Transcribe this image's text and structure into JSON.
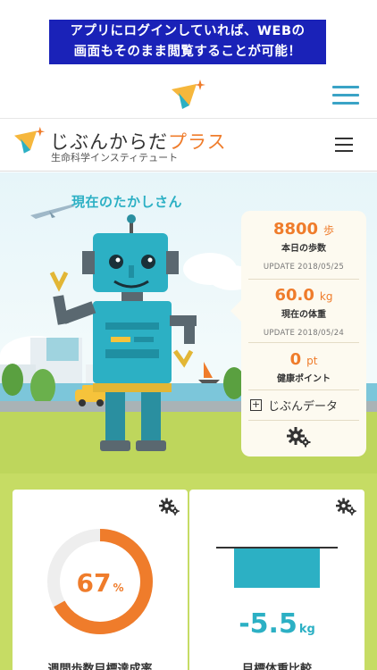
{
  "banner": {
    "line1": "アプリにログインしていれば、WEBの",
    "line2": "画面もそのまま閲覧することが可能！"
  },
  "header": {
    "brand_name_main": "じぶんからだ",
    "brand_name_accent": "プラス",
    "brand_sub": "生命科学インスティテュート"
  },
  "hero": {
    "title": "現在のたかしさん"
  },
  "stats": {
    "steps": {
      "value": "8800",
      "unit": "歩",
      "label": "本日の歩数",
      "update": "UPDATE  2018/05/25"
    },
    "weight": {
      "value": "60.0",
      "unit": "kg",
      "label": "現在の体重",
      "update": "UPDATE  2018/05/24"
    },
    "points": {
      "value": "0",
      "unit": "pt",
      "label": "健康ポイント"
    },
    "link_label": "じぶんデータ",
    "link_icon": "plus-box-icon"
  },
  "cards": {
    "steps_goal": {
      "value": "67",
      "unit": "%",
      "title": "週間歩数目標達成率",
      "progress": 0.67
    },
    "weight_goal": {
      "value": "-5.5",
      "unit": "kg",
      "title": "目標体重比較"
    }
  },
  "colors": {
    "banner": "#1a22b8",
    "accent_orange": "#ef7c2b",
    "accent_teal": "#2cb0c4",
    "grass": "#c6dc64"
  }
}
